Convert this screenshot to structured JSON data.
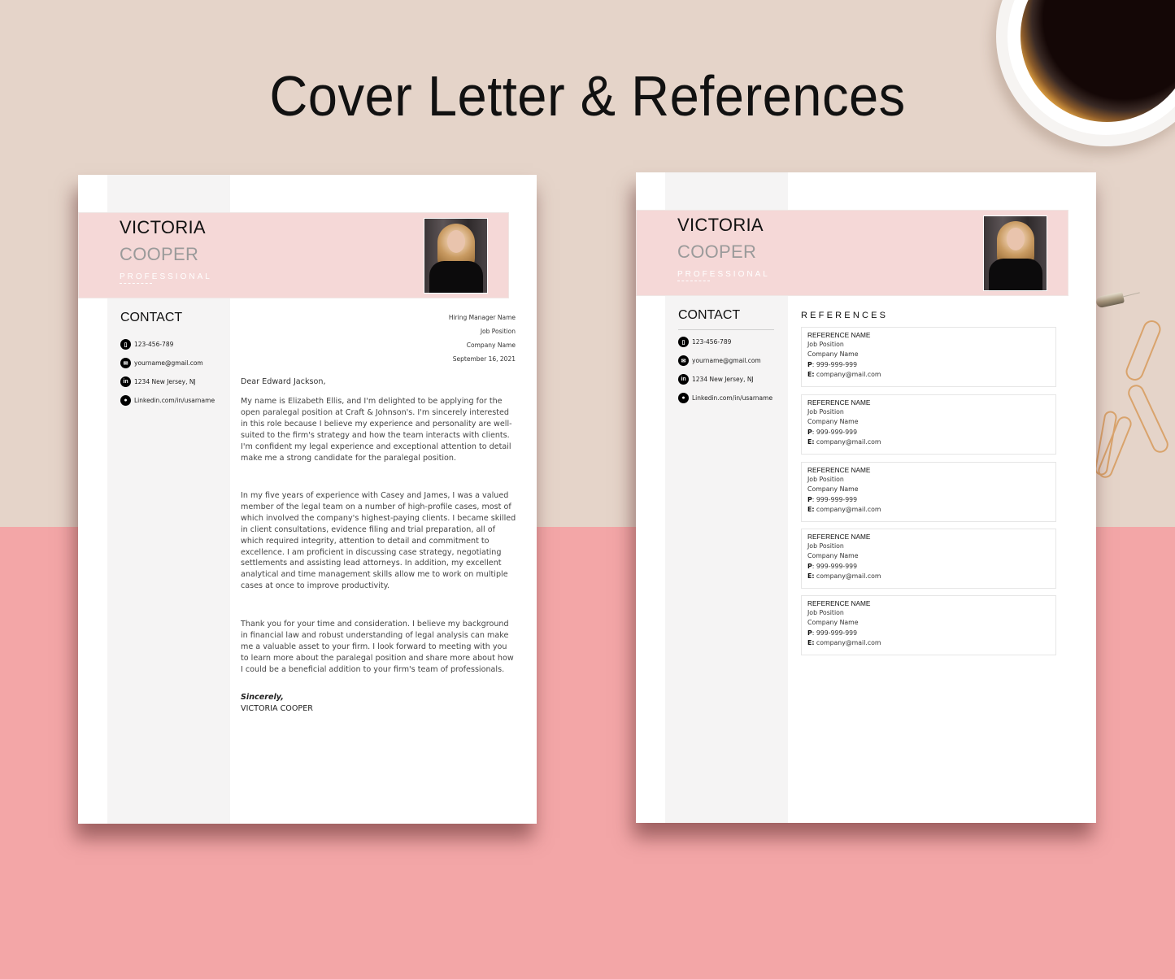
{
  "title": "Cover Letter & References",
  "colors": {
    "background_top": "#e5d4c9",
    "background_bottom": "#f3a6a7",
    "header_band": "#f5d8d7",
    "sidebar": "#f5f4f4",
    "last_name": "#9a9a9a"
  },
  "cover_letter": {
    "first_name": "VICTORIA",
    "last_name": "COOPER",
    "professional_title": "PROFESSIONAL",
    "contact_heading": "CONTACT",
    "contacts": [
      {
        "icon": "phone-icon",
        "glyph": "▯",
        "text": "123-456-789"
      },
      {
        "icon": "mail-icon",
        "glyph": "✉",
        "text": "yourname@gmail.com"
      },
      {
        "icon": "linkedin-icon",
        "glyph": "in",
        "text": "1234 New Jersey, NJ"
      },
      {
        "icon": "location-pin-icon",
        "glyph": "●",
        "text": "Linkedin.com/in/usarname"
      }
    ],
    "recipient": {
      "name": "Hiring Manager Name",
      "position": "Job Position",
      "company": "Company Name",
      "date": "September 16, 2021"
    },
    "salutation": "Dear Edward Jackson,",
    "paragraphs": [
      "My name is Elizabeth Ellis, and I'm delighted to be applying for the open paralegal position at Craft & Johnson's. I'm sincerely interested in this role because I believe my experience and personality are well-suited to the firm's strategy and how the team interacts with clients. I'm confident my legal experience and exceptional attention to detail make me a strong candidate for the paralegal position.",
      "In my five years of experience with Casey and James, I was a valued member of the legal team on a number of high-profile cases, most of which involved the company's highest-paying clients. I became skilled in client consultations, evidence filing and trial preparation, all of which required integrity, attention to detail and commitment to excellence. I am proficient in discussing case strategy, negotiating settlements and assisting lead attorneys. In addition, my excellent analytical and time management skills allow me to work on multiple cases at once to improve productivity.",
      "Thank you for your time and consideration. I believe my background in financial law and robust understanding of legal analysis can make me a valuable asset to your firm. I look forward to meeting with you to learn more about the paralegal position and share more about how I could be a beneficial addition to your firm's team of professionals."
    ],
    "signoff": "Sincerely,",
    "signature": "VICTORIA COOPER"
  },
  "references_page": {
    "first_name": "VICTORIA",
    "last_name": "COOPER",
    "professional_title": "PROFESSIONAL",
    "contact_heading": "CONTACT",
    "contacts": [
      {
        "icon": "phone-icon",
        "glyph": "▯",
        "text": "123-456-789"
      },
      {
        "icon": "mail-icon",
        "glyph": "✉",
        "text": "yourname@gmail.com"
      },
      {
        "icon": "linkedin-icon",
        "glyph": "in",
        "text": "1234 New Jersey, NJ"
      },
      {
        "icon": "location-pin-icon",
        "glyph": "●",
        "text": "Linkedin.com/in/usarname"
      }
    ],
    "references_heading": "REFERENCES",
    "references": [
      {
        "name": "REFERENCE NAME",
        "position": "Job Position",
        "company": "Company Name",
        "phone_label": "P",
        "phone": ": 999-999-999",
        "email_label": "E:",
        "email": " company@mail.com"
      },
      {
        "name": "REFERENCE NAME",
        "position": "Job Position",
        "company": "Company Name",
        "phone_label": "P",
        "phone": ": 999-999-999",
        "email_label": "E:",
        "email": " company@mail.com"
      },
      {
        "name": "REFERENCE NAME",
        "position": "Job Position",
        "company": "Company Name",
        "phone_label": "P",
        "phone": ": 999-999-999",
        "email_label": "E:",
        "email": " company@mail.com"
      },
      {
        "name": "REFERENCE NAME",
        "position": "Job Position",
        "company": "Company Name",
        "phone_label": "P",
        "phone": ": 999-999-999",
        "email_label": "E:",
        "email": " company@mail.com"
      },
      {
        "name": "REFERENCE NAME",
        "position": "Job Position",
        "company": "Company Name",
        "phone_label": "P",
        "phone": ": 999-999-999",
        "email_label": "E:",
        "email": " company@mail.com"
      }
    ]
  }
}
